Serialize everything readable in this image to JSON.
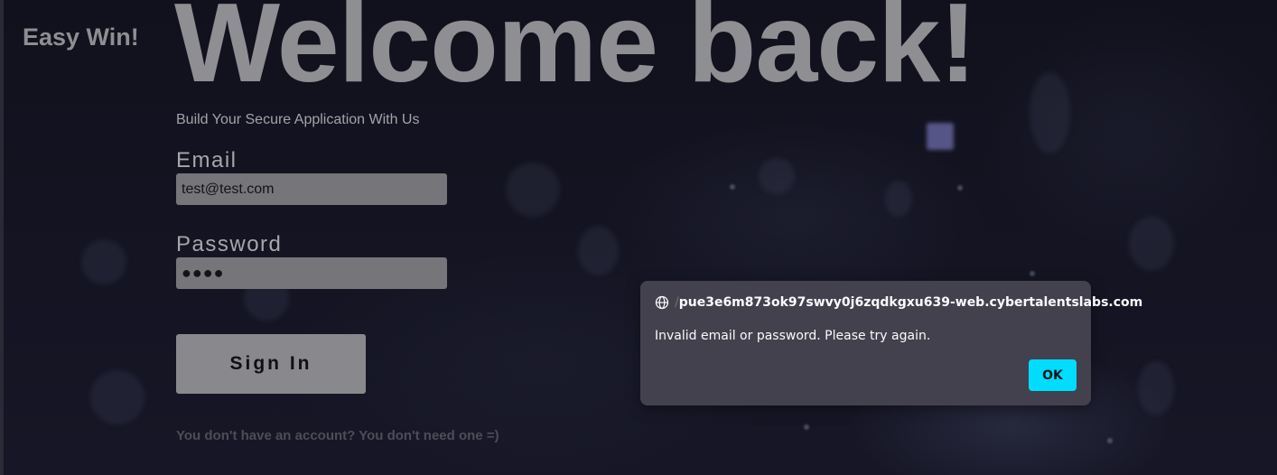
{
  "app": {
    "brand": "Easy Win!"
  },
  "hero": {
    "title": "Welcome back!",
    "subtitle": "Build Your Secure Application With Us"
  },
  "form": {
    "email_label": "Email",
    "email_value": "test@test.com",
    "password_label": "Password",
    "password_masked": "●●●●",
    "submit_label": "Sign In",
    "footer_note": "You don't have an account? You don't need one =)"
  },
  "dialog": {
    "origin_prefix": "/",
    "origin_host": "pue3e6m873ok97swvy0j6zqdkgxu639-web.cybertalentslabs.com",
    "message": "Invalid email or password. Please try again.",
    "ok_label": "OK",
    "icon": "globe-icon"
  },
  "colors": {
    "background": "#10101c",
    "dialog_bg": "#42414d",
    "ok_accent": "#00ddff"
  }
}
